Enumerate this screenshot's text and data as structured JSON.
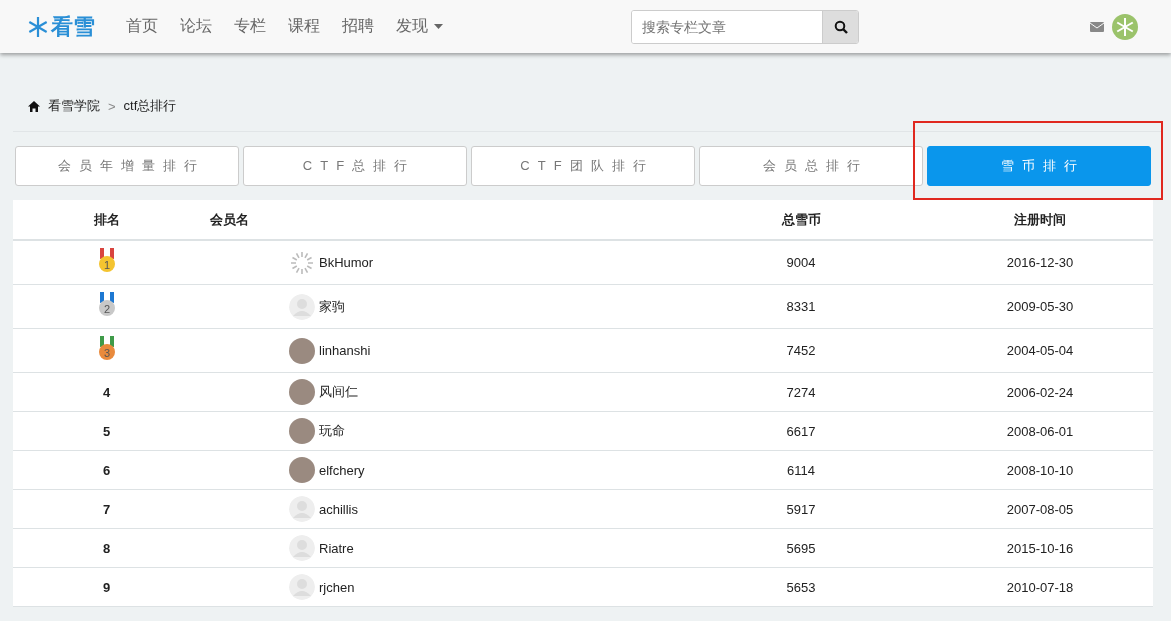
{
  "header": {
    "logo": "看雪",
    "nav": [
      {
        "label": "首页",
        "dropdown": false
      },
      {
        "label": "论坛",
        "dropdown": false
      },
      {
        "label": "专栏",
        "dropdown": false
      },
      {
        "label": "课程",
        "dropdown": false
      },
      {
        "label": "招聘",
        "dropdown": false
      },
      {
        "label": "发现",
        "dropdown": true
      }
    ],
    "search": {
      "placeholder": "搜索专栏文章"
    }
  },
  "breadcrumb": {
    "items": [
      "看雪学院",
      "ctf总排行"
    ],
    "separator": ">"
  },
  "tabs": [
    {
      "label": "会员年增量排行",
      "selected": false,
      "highlighted": false
    },
    {
      "label": "CTF总排行",
      "selected": false,
      "highlighted": false
    },
    {
      "label": "CTF团队排行",
      "selected": false,
      "highlighted": false
    },
    {
      "label": "会员总排行",
      "selected": false,
      "highlighted": false
    },
    {
      "label": "雪币排行",
      "selected": true,
      "highlighted": true
    }
  ],
  "table": {
    "columns": [
      "排名",
      "会员名",
      "总雪币",
      "注册时间"
    ],
    "rows": [
      {
        "rank": "1",
        "kind": "medal",
        "color": "#d9443f",
        "avatar": {
          "kind": "loading"
        },
        "name": "BkHumor",
        "coins": "9004",
        "date": "2016-12-30"
      },
      {
        "rank": "2",
        "kind": "medal",
        "color": "#1e78d2",
        "avatar": {
          "kind": "default"
        },
        "name": "家驹",
        "coins": "8331",
        "date": "2009-05-30"
      },
      {
        "rank": "3",
        "kind": "medal",
        "color": "#3f9b4a",
        "avatar": {
          "kind": "photo"
        },
        "name": "linhanshi",
        "coins": "7452",
        "date": "2004-05-04"
      },
      {
        "rank": "4",
        "kind": "number",
        "avatar": {
          "kind": "photo"
        },
        "name": "风间仁",
        "coins": "7274",
        "date": "2006-02-24"
      },
      {
        "rank": "5",
        "kind": "number",
        "avatar": {
          "kind": "photo"
        },
        "name": "玩命",
        "coins": "6617",
        "date": "2008-06-01"
      },
      {
        "rank": "6",
        "kind": "number",
        "avatar": {
          "kind": "photo"
        },
        "name": "elfchery",
        "coins": "6114",
        "date": "2008-10-10"
      },
      {
        "rank": "7",
        "kind": "number",
        "avatar": {
          "kind": "default"
        },
        "name": "achillis",
        "coins": "5917",
        "date": "2007-08-05"
      },
      {
        "rank": "8",
        "kind": "number",
        "avatar": {
          "kind": "default"
        },
        "name": "Riatre",
        "coins": "5695",
        "date": "2015-10-16"
      },
      {
        "rank": "9",
        "kind": "number",
        "avatar": {
          "kind": "default"
        },
        "name": "rjchen",
        "coins": "5653",
        "date": "2010-07-18"
      }
    ]
  }
}
